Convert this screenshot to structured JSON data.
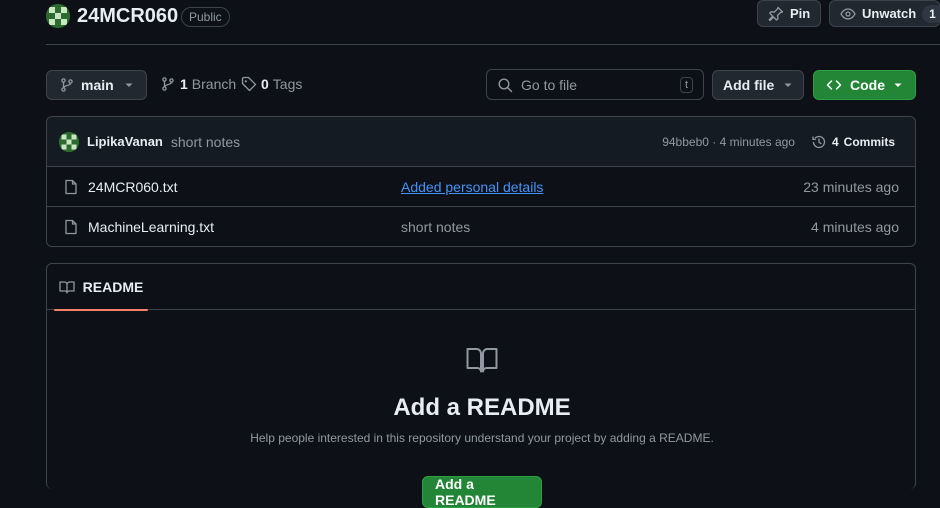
{
  "repo": {
    "name": "24MCR060",
    "visibility": "Public"
  },
  "actions": {
    "pin_label": "Pin",
    "unwatch_label": "Unwatch",
    "watch_count": "1"
  },
  "toolbar": {
    "branch": "main",
    "branch_count": "1",
    "branch_label": "Branch",
    "tag_count": "0",
    "tag_label": "Tags",
    "search_placeholder": "Go to file",
    "search_shortcut": "t",
    "add_file_label": "Add file",
    "code_label": "Code"
  },
  "latest_commit": {
    "author": "LipikaVanan",
    "message": "short notes",
    "hash_time": "94bbeb0 · 4 minutes ago",
    "commit_count": "4",
    "commit_label": "Commits"
  },
  "files": [
    {
      "name": "24MCR060.txt",
      "message": "Added personal details",
      "time": "23 minutes ago"
    },
    {
      "name": "MachineLearning.txt",
      "message": "short notes",
      "time": "4 minutes ago"
    }
  ],
  "readme": {
    "tab_label": "README",
    "heading": "Add a README",
    "description": "Help people interested in this repository understand your project by adding a README.",
    "button_label": "Add a README"
  },
  "colors": {
    "background": "#0d1117",
    "accent_green": "#238636",
    "link_blue": "#4493f8",
    "tab_underline": "#f78166"
  }
}
